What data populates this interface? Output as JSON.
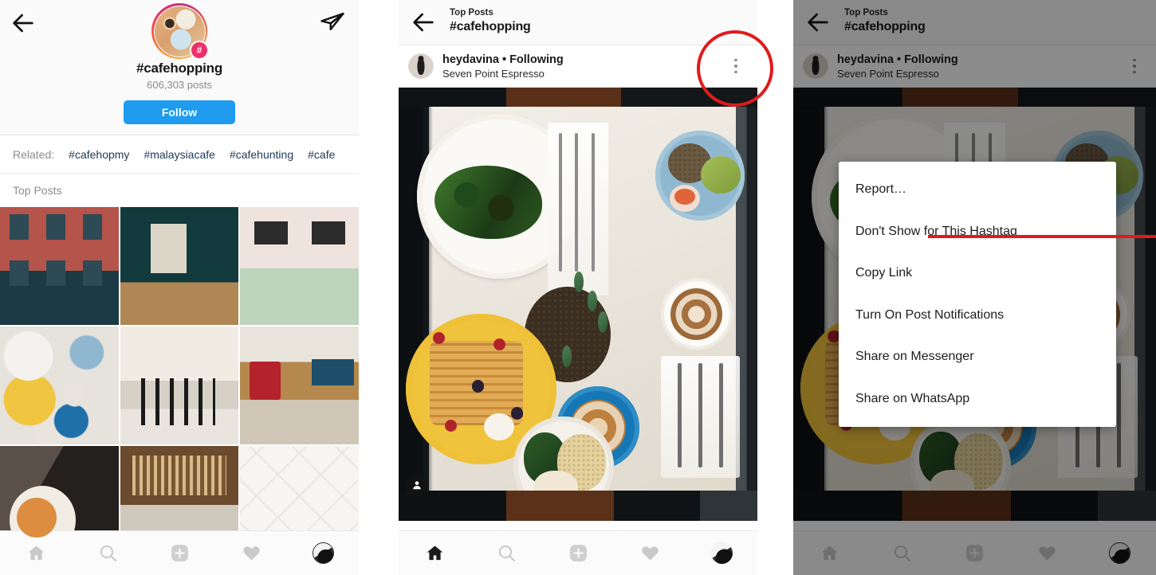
{
  "panel1": {
    "name": "hashtag-explore-screen",
    "header": {
      "back_icon": "back-arrow-icon",
      "share_icon": "direct-share-icon",
      "hashtag_badge": "#",
      "title": "#cafehopping",
      "post_count": "606,303 posts",
      "follow_label": "Follow",
      "follow_color": "#1f9bf0"
    },
    "related": {
      "label": "Related:",
      "tags": [
        "#cafehopmy",
        "#malaysiacafe",
        "#cafehunting",
        "#cafe"
      ]
    },
    "section_label": "Top Posts",
    "grid": [
      {
        "alt": "brick-cafe-storefront"
      },
      {
        "alt": "green-lounge-interior"
      },
      {
        "alt": "cafe-counter-barista"
      },
      {
        "alt": "brunch-flatlay-waffles"
      },
      {
        "alt": "cafe-dining-room-chairs"
      },
      {
        "alt": "latte-red-handbag-table"
      },
      {
        "alt": "table-soup-and-coffee"
      },
      {
        "alt": "deli-shelves-counter"
      },
      {
        "alt": "white-tiled-wall-lamp"
      }
    ],
    "nav": [
      {
        "name": "home-icon",
        "label": "Home",
        "active": false
      },
      {
        "name": "search-icon",
        "label": "Search",
        "active": false
      },
      {
        "name": "add-post-icon",
        "label": "New Post",
        "active": false
      },
      {
        "name": "heart-icon",
        "label": "Activity",
        "active": false
      },
      {
        "name": "profile-avatar-icon",
        "label": "Profile",
        "active": false
      }
    ]
  },
  "panel2": {
    "name": "post-detail-screen",
    "topbar": {
      "back_icon": "back-arrow-icon",
      "subtitle": "Top Posts",
      "title": "#cafehopping"
    },
    "post": {
      "avatar": "user-avatar",
      "username": "heydavina",
      "separator": "•",
      "follow_state": "Following",
      "location": "Seven Point Espresso",
      "more_icon": "three-dots-icon",
      "photo_alt": "overhead-brunch-table-flatlay",
      "tag_badge_icon": "person-tag-icon"
    },
    "annotation": {
      "type": "circle",
      "color": "#e01b1b",
      "target": "three-dots-icon"
    },
    "nav": [
      {
        "name": "home-icon",
        "label": "Home",
        "active": true
      },
      {
        "name": "search-icon",
        "label": "Search",
        "active": false
      },
      {
        "name": "add-post-icon",
        "label": "New Post",
        "active": false
      },
      {
        "name": "heart-icon",
        "label": "Activity",
        "active": false
      },
      {
        "name": "profile-avatar-icon",
        "label": "Profile",
        "active": false
      }
    ]
  },
  "panel3": {
    "name": "post-options-menu-screen",
    "topbar": {
      "back_icon": "back-arrow-icon",
      "subtitle": "Top Posts",
      "title": "#cafehopping"
    },
    "post": {
      "avatar": "user-avatar",
      "username": "heydavina",
      "separator": "•",
      "follow_state": "Following",
      "location": "Seven Point Espresso",
      "more_icon": "three-dots-icon"
    },
    "menu": {
      "items": [
        {
          "label": "Report…",
          "name": "menu-item-report"
        },
        {
          "label": "Don't Show for This Hashtag",
          "name": "menu-item-dont-show-for-this-hashtag"
        },
        {
          "label": "Copy Link",
          "name": "menu-item-copy-link"
        },
        {
          "label": "Turn On Post Notifications",
          "name": "menu-item-turn-on-post-notifications"
        },
        {
          "label": "Share on Messenger",
          "name": "menu-item-share-on-messenger"
        },
        {
          "label": "Share on WhatsApp",
          "name": "menu-item-share-on-whatsapp"
        }
      ]
    },
    "annotation": {
      "type": "underline-pointer",
      "color": "#e01b1b",
      "target": "menu-item-dont-show-for-this-hashtag"
    },
    "nav": [
      {
        "name": "home-icon",
        "label": "Home",
        "active": false
      },
      {
        "name": "search-icon",
        "label": "Search",
        "active": false
      },
      {
        "name": "add-post-icon",
        "label": "New Post",
        "active": false
      },
      {
        "name": "heart-icon",
        "label": "Activity",
        "active": false
      },
      {
        "name": "profile-avatar-icon",
        "label": "Profile",
        "active": false
      }
    ]
  }
}
